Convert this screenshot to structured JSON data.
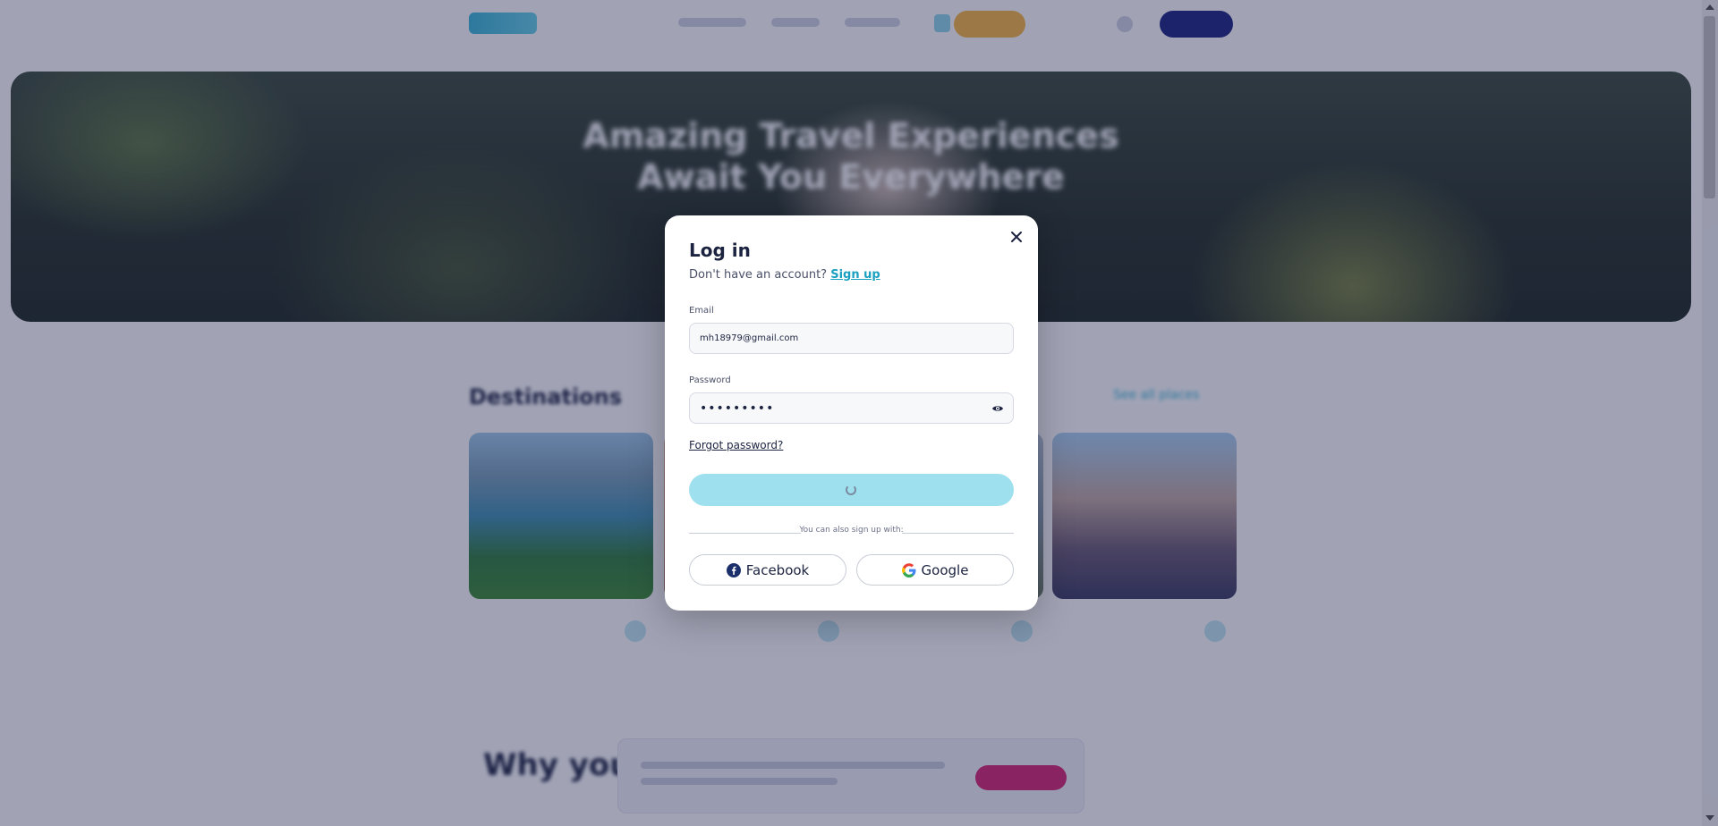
{
  "hero": {
    "title_line1": "Amazing Travel Experiences",
    "title_line2": "Await You Everywhere"
  },
  "destinations": {
    "title": "Destinations",
    "see_all": "See all places"
  },
  "why": {
    "title": "Why you"
  },
  "login_modal": {
    "title": "Log in",
    "no_account_text": "Don't have an account?",
    "signup_link": "Sign up",
    "email_label": "Email",
    "email_value": "mh18979@gmail.com",
    "password_label": "Password",
    "password_value": "•••••••••",
    "forgot_password": "Forgot password?",
    "submit_state": "loading",
    "divider_text": "You can also sign up with:",
    "facebook_label": "Facebook",
    "google_label": "Google"
  },
  "icons": {
    "close": "close-icon",
    "eye": "eye-icon",
    "facebook": "facebook-icon",
    "google": "google-icon",
    "spinner": "spinner-icon"
  },
  "colors": {
    "overlay": "#1e244e",
    "accent": "#1aa0c0",
    "submit_bg": "#9fe0ee",
    "text": "#1c2340",
    "facebook": "#1b2f6b",
    "nav_cta": "#f5b63f",
    "nav_signin": "#1b2380",
    "cookie_accept": "#d6246e"
  }
}
